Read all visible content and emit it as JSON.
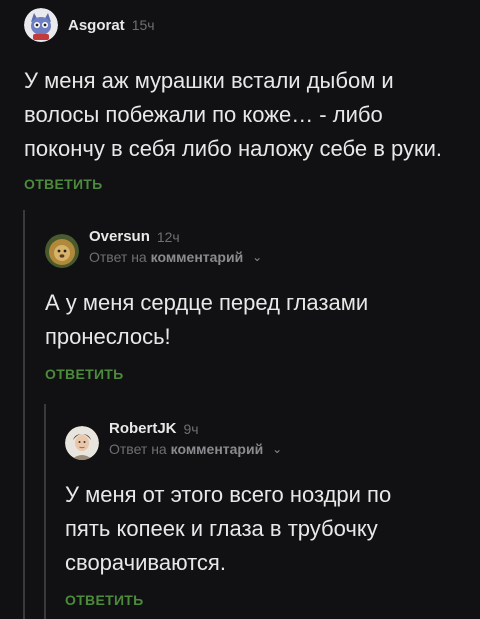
{
  "comments": [
    {
      "user": "Asgorat",
      "time": "15ч",
      "text": "У меня аж мурашки встали дыбом и волосы побежали по коже… - либо покончу в себя либо наложу себе в руки.",
      "reply_label": "ОТВЕТИТЬ",
      "avatar_icon": "cat-avatar-icon"
    },
    {
      "user": "Oversun",
      "time": "12ч",
      "reply_to_prefix": "Ответ на",
      "reply_to_target": "комментарий",
      "text": "А у меня сердце перед глазами пронеслось!",
      "reply_label": "ОТВЕТИТЬ",
      "avatar_icon": "lion-avatar-icon"
    },
    {
      "user": "RobertJK",
      "time": "9ч",
      "reply_to_prefix": "Ответ на",
      "reply_to_target": "комментарий",
      "text": "У меня от этого всего ноздри по пять копеек и глаза в трубочку сворачиваются.",
      "reply_label": "ОТВЕТИТЬ",
      "avatar_icon": "person-avatar-icon"
    }
  ],
  "colors": {
    "background": "#111113",
    "accent_green": "#4c8a3c",
    "thread_line": "#3a3a3d",
    "muted": "#6f6f73"
  }
}
